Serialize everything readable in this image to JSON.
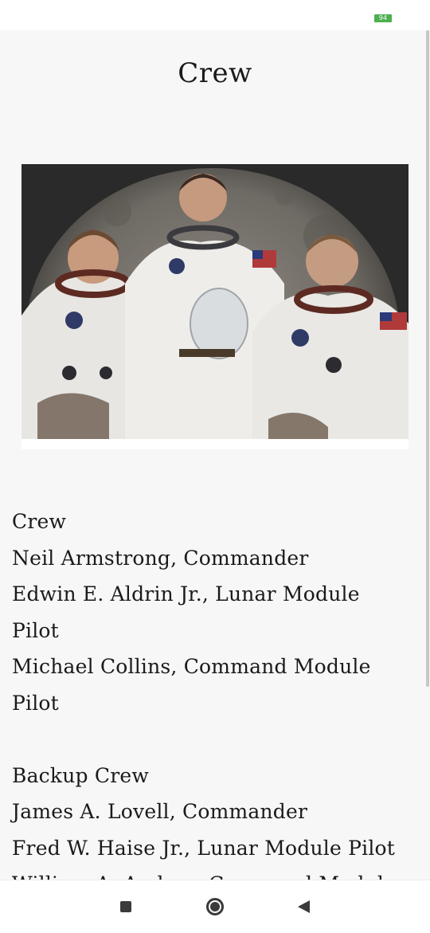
{
  "status_bar": {
    "battery_level": "94",
    "battery_color": "#4caf50"
  },
  "page": {
    "title": "Crew"
  },
  "photo": {
    "icon": "crew-photo"
  },
  "crew": {
    "heading": "Crew",
    "members": [
      "Neil Armstrong, Commander",
      "Edwin E. Aldrin Jr., Lunar Module",
      "Pilot",
      "Michael Collins, Command Module",
      "Pilot"
    ]
  },
  "backup_crew": {
    "heading": "Backup Crew",
    "members": [
      "James A. Lovell, Commander",
      "Fred W. Haise Jr., Lunar Module Pilot",
      "William A. Anders, Command Module"
    ]
  },
  "nav_bar": {
    "recents": "recents-icon",
    "home": "home-icon",
    "back": "back-icon"
  }
}
